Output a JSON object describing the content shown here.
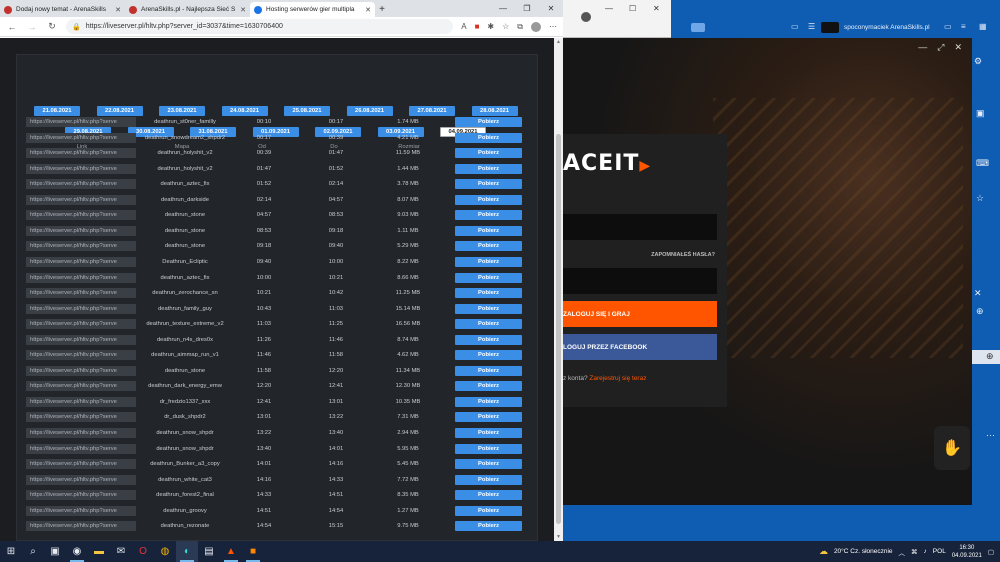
{
  "browser": {
    "tabs": [
      {
        "label": "Dodaj nowy temat - ArenaSkills"
      },
      {
        "label": "ArenaSkills.pl - Najlepsza Sieć S"
      },
      {
        "label": "Hosting serwerów gier multipla"
      }
    ],
    "url": "https://liveserver.pl/hltv.php?server_id=3037&time=1630706400"
  },
  "dates_row1": [
    "21.08.2021",
    "22.08.2021",
    "23.08.2021",
    "24.08.2021",
    "25.08.2021",
    "26.08.2021",
    "27.08.2021",
    "28.08.2021"
  ],
  "dates_row2": [
    "29.08.2021",
    "30.08.2021",
    "31.08.2021",
    "01.09.2021",
    "02.09.2021",
    "03.09.2021",
    "04.09.2021"
  ],
  "current_date": "04.09.2021",
  "table": {
    "headers": {
      "link": "Link",
      "map": "Mapa",
      "od": "Od",
      "do": "Do",
      "size": "Rozmiar"
    },
    "download_label": "Pobierz",
    "rows": [
      {
        "link": "https://liveserver.pl/hltv.php?serve",
        "map": "deathrun_st0ner_familly",
        "od": "00:10",
        "do": "00:17",
        "size": "1.74 MB"
      },
      {
        "link": "https://liveserver.pl/hltv.php?serve",
        "map": "deathrun_snowdream2_shpdr2",
        "od": "00:17",
        "do": "00:39",
        "size": "4.21 MB"
      },
      {
        "link": "https://liveserver.pl/hltv.php?serve",
        "map": "deathrun_holyshit_v2",
        "od": "00:39",
        "do": "01:47",
        "size": "11.59 MB"
      },
      {
        "link": "https://liveserver.pl/hltv.php?serve",
        "map": "deathrun_holyshit_v2",
        "od": "01:47",
        "do": "01:52",
        "size": "1.44 MB"
      },
      {
        "link": "https://liveserver.pl/hltv.php?serve",
        "map": "deathrun_aztec_fix",
        "od": "01:52",
        "do": "02:14",
        "size": "3.78 MB"
      },
      {
        "link": "https://liveserver.pl/hltv.php?serve",
        "map": "deathrun_darkside",
        "od": "02:14",
        "do": "04:57",
        "size": "8.07 MB"
      },
      {
        "link": "https://liveserver.pl/hltv.php?serve",
        "map": "deathrun_stone",
        "od": "04:57",
        "do": "08:53",
        "size": "9.03 MB"
      },
      {
        "link": "https://liveserver.pl/hltv.php?serve",
        "map": "deathrun_stone",
        "od": "08:53",
        "do": "09:18",
        "size": "1.11 MB"
      },
      {
        "link": "https://liveserver.pl/hltv.php?serve",
        "map": "deathrun_stone",
        "od": "09:18",
        "do": "09:40",
        "size": "5.29 MB"
      },
      {
        "link": "https://liveserver.pl/hltv.php?serve",
        "map": "Deathrun_Ecliptic",
        "od": "09:40",
        "do": "10:00",
        "size": "8.22 MB"
      },
      {
        "link": "https://liveserver.pl/hltv.php?serve",
        "map": "deathrun_aztec_fix",
        "od": "10:00",
        "do": "10:21",
        "size": "8.66 MB"
      },
      {
        "link": "https://liveserver.pl/hltv.php?serve",
        "map": "deathrun_zerochance_sn",
        "od": "10:21",
        "do": "10:42",
        "size": "11.25 MB"
      },
      {
        "link": "https://liveserver.pl/hltv.php?serve",
        "map": "deathrun_family_guy",
        "od": "10:43",
        "do": "11:03",
        "size": "15.14 MB"
      },
      {
        "link": "https://liveserver.pl/hltv.php?serve",
        "map": "deathrun_texture_extreme_v2",
        "od": "11:03",
        "do": "11:25",
        "size": "16.56 MB"
      },
      {
        "link": "https://liveserver.pl/hltv.php?serve",
        "map": "deathrun_n4s_dres0x",
        "od": "11:26",
        "do": "11:46",
        "size": "8.74 MB"
      },
      {
        "link": "https://liveserver.pl/hltv.php?serve",
        "map": "deathrun_aimmap_run_v1",
        "od": "11:46",
        "do": "11:58",
        "size": "4.62 MB"
      },
      {
        "link": "https://liveserver.pl/hltv.php?serve",
        "map": "deathrun_stone",
        "od": "11:58",
        "do": "12:20",
        "size": "11.34 MB"
      },
      {
        "link": "https://liveserver.pl/hltv.php?serve",
        "map": "deathrun_dark_energy_emw",
        "od": "12:20",
        "do": "12:41",
        "size": "12.30 MB"
      },
      {
        "link": "https://liveserver.pl/hltv.php?serve",
        "map": "dr_fredzio1337_xxx",
        "od": "12:41",
        "do": "13:01",
        "size": "10.35 MB"
      },
      {
        "link": "https://liveserver.pl/hltv.php?serve",
        "map": "dr_dusk_shpdr2",
        "od": "13:01",
        "do": "13:22",
        "size": "7.31 MB"
      },
      {
        "link": "https://liveserver.pl/hltv.php?serve",
        "map": "deathrun_snow_shpdr",
        "od": "13:22",
        "do": "13:40",
        "size": "2.94 MB"
      },
      {
        "link": "https://liveserver.pl/hltv.php?serve",
        "map": "deathrun_snow_shpdr",
        "od": "13:40",
        "do": "14:01",
        "size": "5.95 MB"
      },
      {
        "link": "https://liveserver.pl/hltv.php?serve",
        "map": "deathrun_Bunker_a3_copy",
        "od": "14:01",
        "do": "14:16",
        "size": "5.45 MB"
      },
      {
        "link": "https://liveserver.pl/hltv.php?serve",
        "map": "deathrun_white_cat3",
        "od": "14:16",
        "do": "14:33",
        "size": "7.72 MB"
      },
      {
        "link": "https://liveserver.pl/hltv.php?serve",
        "map": "deathrun_forest2_final",
        "od": "14:33",
        "do": "14:51",
        "size": "8.35 MB"
      },
      {
        "link": "https://liveserver.pl/hltv.php?serve",
        "map": "deathrun_groovy",
        "od": "14:51",
        "do": "14:54",
        "size": "1.27 MB"
      },
      {
        "link": "https://liveserver.pl/hltv.php?serve",
        "map": "deathrun_rezonate",
        "od": "14:54",
        "do": "15:15",
        "size": "9.75 MB"
      }
    ]
  },
  "faceit": {
    "logo": "ACEIT",
    "forgot_password": "ZAPOMNIAŁEŚ HASŁA?",
    "login_button": "ZALOGUJ SIĘ I GRAJ",
    "facebook_button": "LOGUJ PRZEZ FACEBOOK",
    "signup_prefix": "z konta?",
    "signup_link": "Zarejestruj się teraz"
  },
  "app_user": "spoconymaciek ArenaSkills.pl",
  "taskbar": {
    "weather": "20°C  Cz. słonecznie",
    "language": "POL",
    "time": "16:30",
    "date": "04.09.2021"
  },
  "colors": {
    "accent_blue": "#3a8ee6",
    "faceit_orange": "#ff5500",
    "facebook_blue": "#3b5998",
    "desktop_blue": "#0e5db3"
  }
}
